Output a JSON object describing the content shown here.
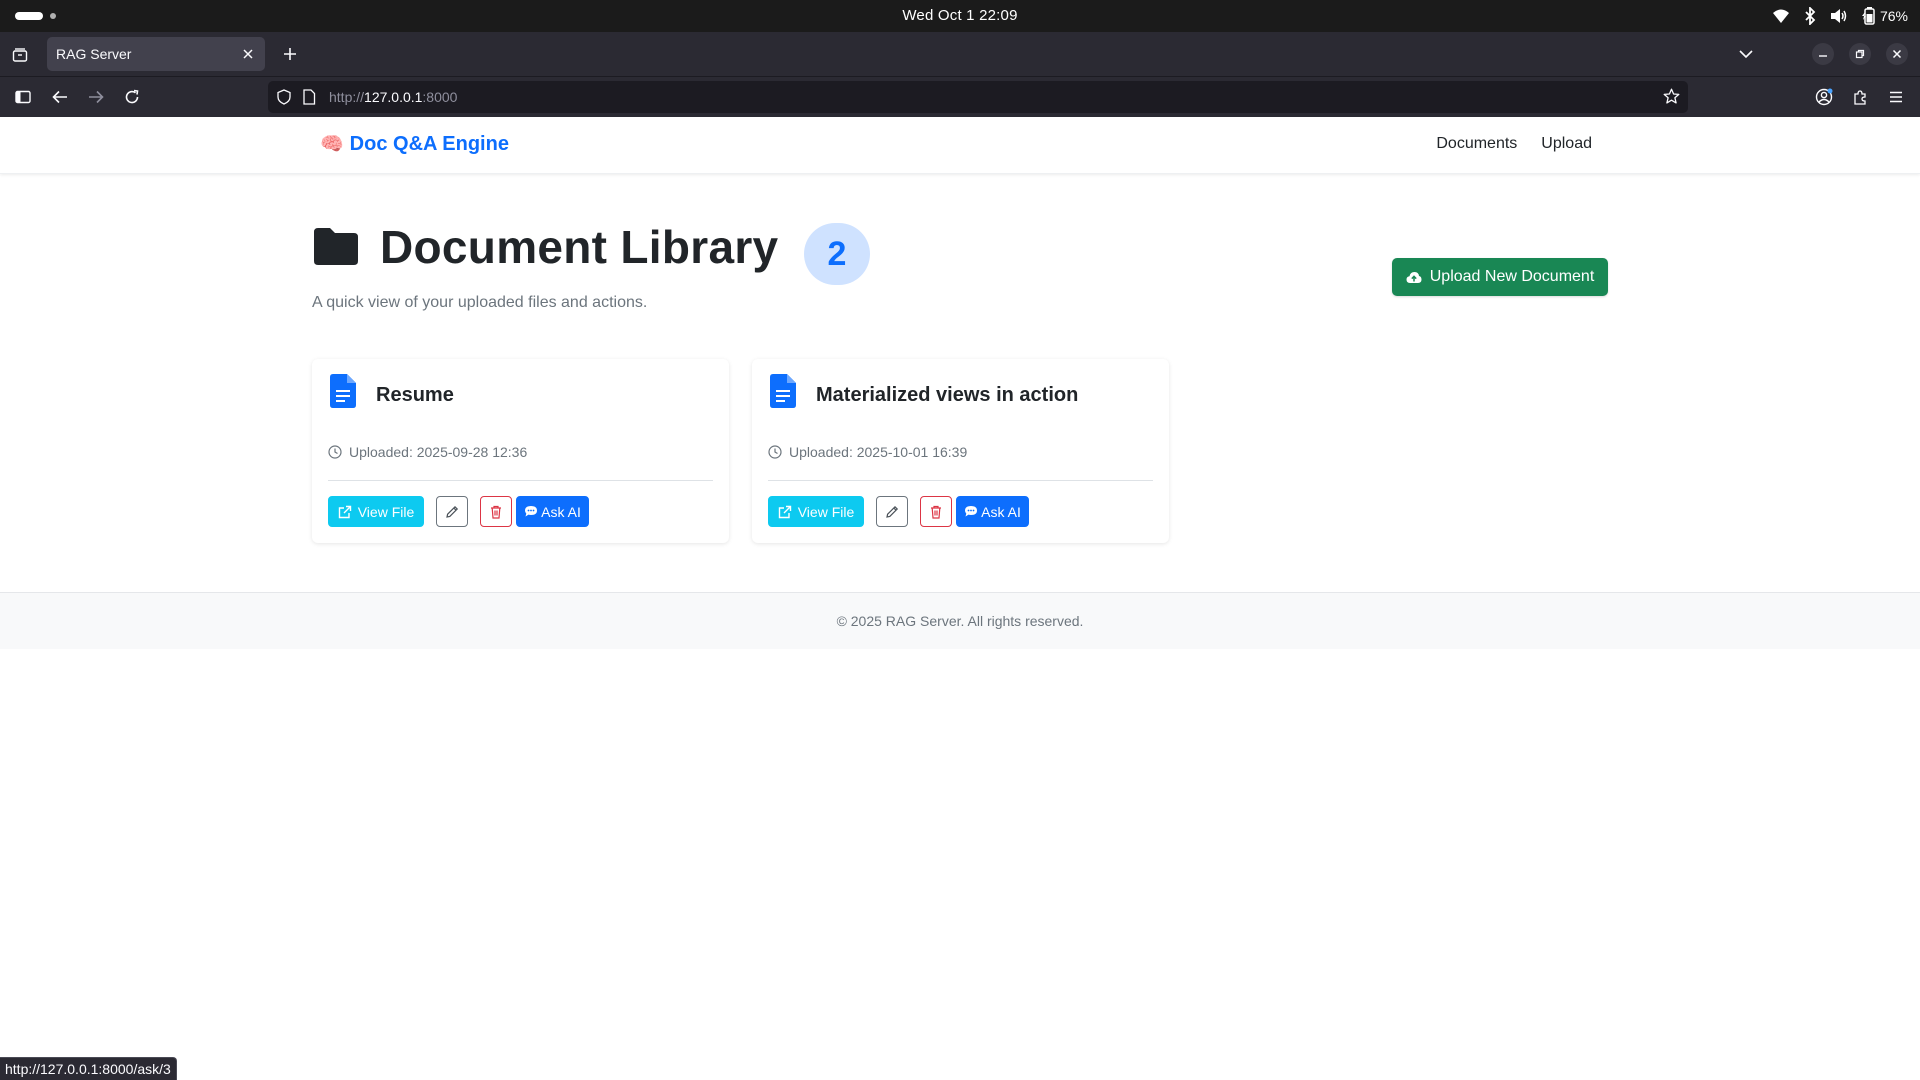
{
  "os": {
    "clock": "Wed Oct 1  22:09",
    "battery": "76%"
  },
  "browser": {
    "tab_title": "RAG Server",
    "url_scheme": "http://",
    "url_host": "127.0.0.1",
    "url_port": ":8000",
    "status_url": "http://127.0.0.1:8000/ask/3"
  },
  "site": {
    "brand_emoji": "🧠",
    "brand": "Doc Q&A Engine",
    "nav": [
      "Documents",
      "Upload"
    ]
  },
  "header": {
    "title": "Document Library",
    "count": "2",
    "subtitle": "A quick view of your uploaded files and actions.",
    "upload_label": "Upload New Document"
  },
  "documents": [
    {
      "title": "Resume",
      "uploaded": "Uploaded: 2025-09-28 12:36",
      "view_label": "View File",
      "ask_label": "Ask AI"
    },
    {
      "title": "Materialized views in action",
      "uploaded": "Uploaded: 2025-10-01 16:39",
      "view_label": "View File",
      "ask_label": "Ask AI"
    }
  ],
  "footer": {
    "text": "© 2025 RAG Server. All rights reserved."
  },
  "colors": {
    "primary": "#0d6efd",
    "success": "#198754",
    "info": "#0dcaf0",
    "danger": "#dc3545",
    "badge_bg": "#cfe2ff"
  }
}
